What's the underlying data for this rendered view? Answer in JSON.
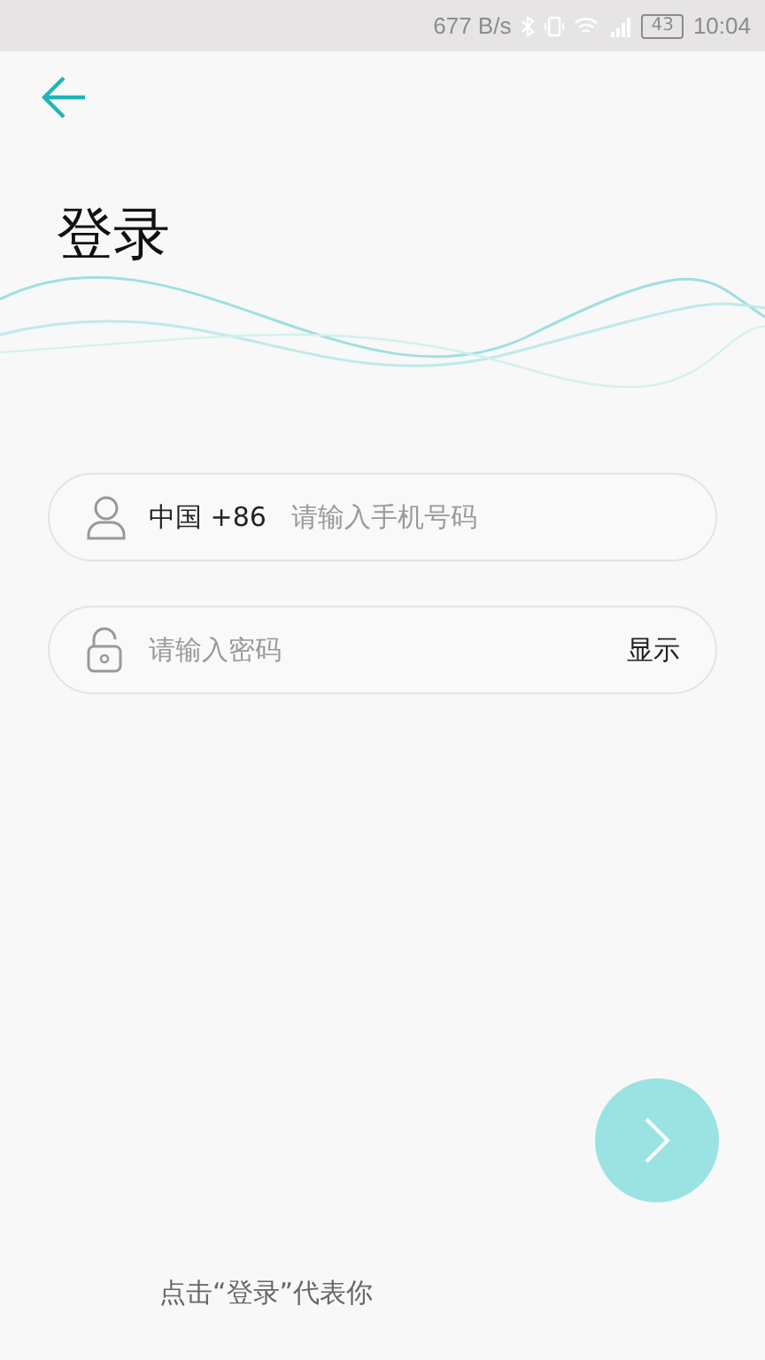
{
  "status_bar": {
    "speed": "677 B/s",
    "battery": "43",
    "time": "10:04"
  },
  "title": "登录",
  "phone_field": {
    "country": "中国 +86",
    "placeholder": "请输入手机号码"
  },
  "password_field": {
    "placeholder": "请输入密码",
    "toggle": "显示"
  },
  "footer": "点击“登录”代表你"
}
